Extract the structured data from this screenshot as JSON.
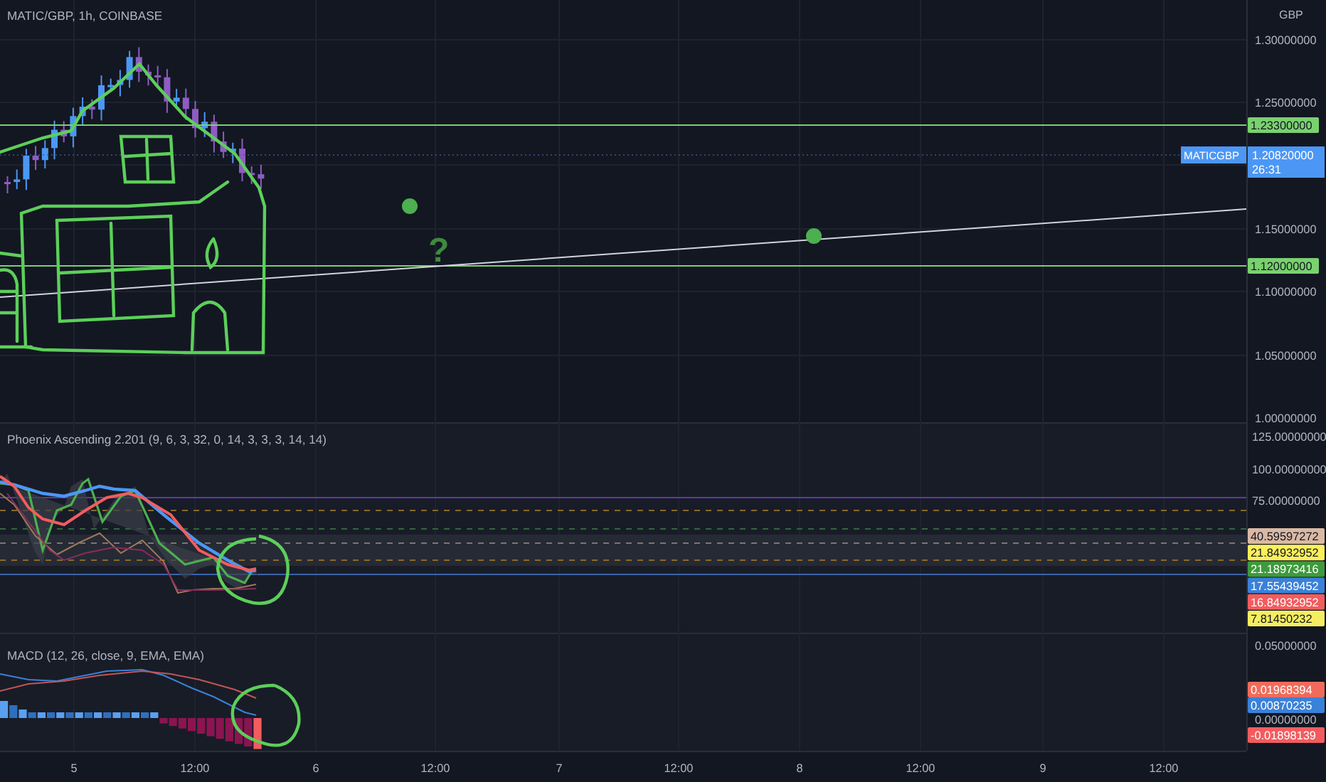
{
  "main_pane": {
    "title": "MATIC/GBP, 1h, COINBASE",
    "currency": "GBP",
    "annotation": "?",
    "price_scale": [
      "1.30000000",
      "1.25000000",
      "1.15000000",
      "1.10000000",
      "1.05000000",
      "1.00000000"
    ],
    "horizontal_lines": [
      {
        "price": "1.23300000",
        "color": "#7ad16f"
      },
      {
        "price": "1.12000000",
        "color": "#7ad16f"
      }
    ],
    "last_price": {
      "symbol": "MATICGBP",
      "price": "1.20820000",
      "countdown": "26:31",
      "color": "#4c97f5"
    }
  },
  "indicator_pane": {
    "title": "Phoenix Ascending 2.201 (9, 6, 3, 32, 0, 14, 3, 3, 3, 14, 14)",
    "scale": [
      "125.00000000",
      "100.00000000",
      "75.00000000"
    ],
    "value_badges": [
      {
        "value": "40.59597272",
        "color": "#d9b9a4"
      },
      {
        "value": "21.84932952",
        "color": "#fcef5b"
      },
      {
        "value": "21.18973416",
        "color": "#3e9a3c"
      },
      {
        "value": "17.55439452",
        "color": "#3a81d8"
      },
      {
        "value": "16.84932952",
        "color": "#f25c5f"
      },
      {
        "value": "7.81450232",
        "color": "#f6ee60"
      }
    ]
  },
  "macd_pane": {
    "title": "MACD (12, 26, close, 9, EMA, EMA)",
    "scale": [
      "0.05000000",
      "0.00000000"
    ],
    "value_badges": [
      {
        "value": "0.01968394",
        "color": "#f06b5b"
      },
      {
        "value": "0.00870235",
        "color": "#3a81d8"
      },
      {
        "value": "-0.01898139",
        "color": "#f25c5f"
      }
    ]
  },
  "time_axis": [
    "5",
    "12:00",
    "6",
    "12:00",
    "7",
    "12:00",
    "8",
    "12:00",
    "9",
    "12:00"
  ]
}
